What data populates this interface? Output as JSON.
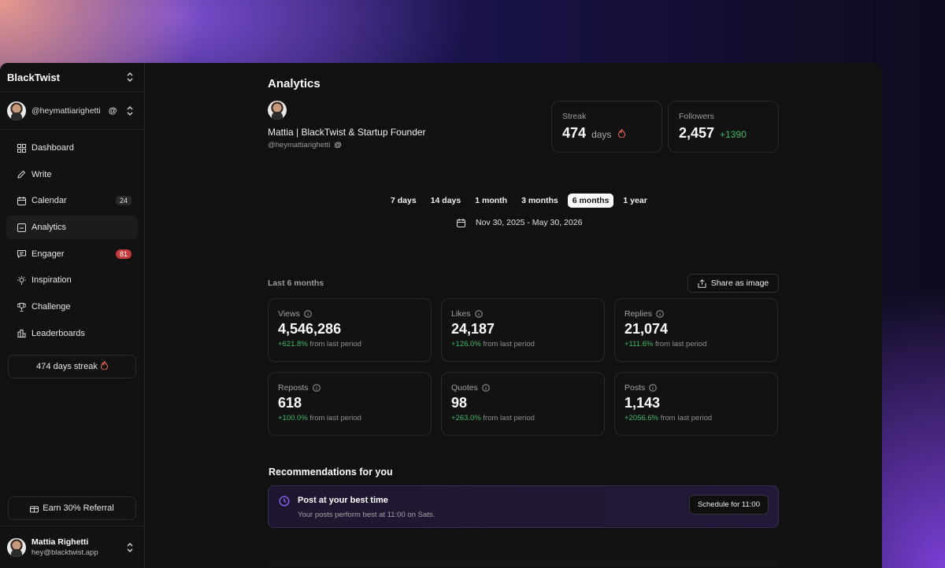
{
  "app": {
    "name": "BlackTwist"
  },
  "account": {
    "handle": "@heymattiarighetti"
  },
  "sidebar": {
    "items": [
      {
        "label": "Dashboard",
        "icon": "grid-icon"
      },
      {
        "label": "Write",
        "icon": "pencil-icon"
      },
      {
        "label": "Calendar",
        "icon": "calendar-icon",
        "badge": "24"
      },
      {
        "label": "Analytics",
        "icon": "chart-icon",
        "active": true
      },
      {
        "label": "Engager",
        "icon": "message-icon",
        "badge": "81"
      },
      {
        "label": "Inspiration",
        "icon": "bulb-icon"
      },
      {
        "label": "Challenge",
        "icon": "trophy-icon"
      },
      {
        "label": "Leaderboards",
        "icon": "podium-icon"
      }
    ],
    "streak": "474 days streak",
    "referral": "Earn 30% Referral"
  },
  "user": {
    "name": "Mattia Righetti",
    "email": "hey@blacktwist.app"
  },
  "page": {
    "title": "Analytics",
    "profile_name": "Mattia | BlackTwist & Startup Founder",
    "profile_handle": "@heymattiarighetti"
  },
  "stats": {
    "streak": {
      "label": "Streak",
      "value": "474",
      "unit": "days"
    },
    "followers": {
      "label": "Followers",
      "value": "2,457",
      "delta": "+1390"
    }
  },
  "ranges": [
    "7 days",
    "14 days",
    "1 month",
    "3 months",
    "6 months",
    "1 year"
  ],
  "selected_range": "6 months",
  "date_range": "Nov 30, 2025 - May 30, 2026",
  "section": {
    "label": "Last 6 months",
    "share": "Share as image"
  },
  "metrics": [
    {
      "label": "Views",
      "value": "4,546,286",
      "change": "+621.8%",
      "suffix": "from last period"
    },
    {
      "label": "Likes",
      "value": "24,187",
      "change": "+126.0%",
      "suffix": "from last period"
    },
    {
      "label": "Replies",
      "value": "21,074",
      "change": "+111.6%",
      "suffix": "from last period"
    },
    {
      "label": "Reposts",
      "value": "618",
      "change": "+100.0%",
      "suffix": "from last period"
    },
    {
      "label": "Quotes",
      "value": "98",
      "change": "+263.0%",
      "suffix": "from last period"
    },
    {
      "label": "Posts",
      "value": "1,143",
      "change": "+2056.6%",
      "suffix": "from last period"
    }
  ],
  "recommendations": {
    "title": "Recommendations for you",
    "item": {
      "title": "Post at your best time",
      "description": "Your posts perform best at 11:00 on Sats.",
      "button": "Schedule for 11:00"
    }
  },
  "colors": {
    "positive": "#3fb96a",
    "badge_red": "#c53a3a",
    "accent_purple": "#8b5cf6"
  }
}
